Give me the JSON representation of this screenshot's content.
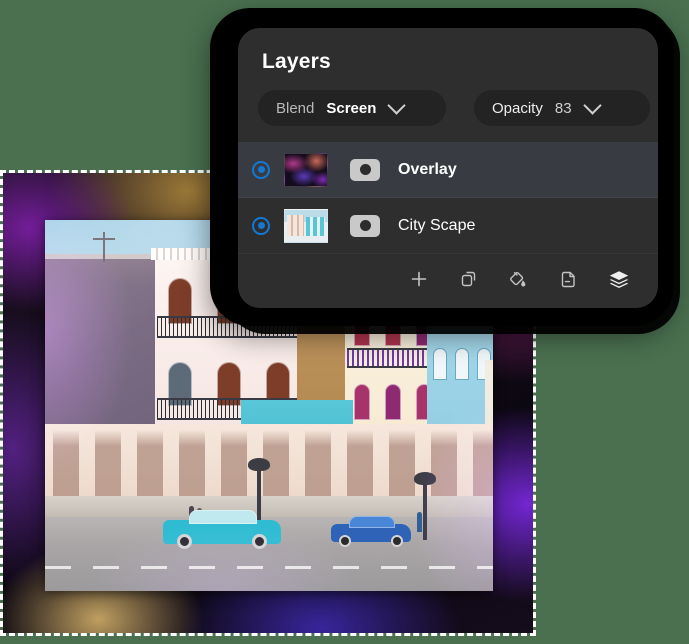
{
  "app": {
    "background_color": "#4a7050",
    "panel_bg": "#2e2e2e",
    "panel_frame_color": "#000000",
    "accent_color": "#1478d4",
    "selected_row_color": "#383c42"
  },
  "panel": {
    "title": "Layers",
    "controls": {
      "blend": {
        "label": "Blend",
        "value": "Screen",
        "chevron_icon": "chevron-down-icon"
      },
      "opacity": {
        "label": "Opacity",
        "value": "83",
        "chevron_icon": "chevron-down-icon"
      }
    },
    "layers": [
      {
        "name": "Overlay",
        "selected": true,
        "visible": true,
        "visibility_icon": "visibility-radio-icon",
        "thumbnail": "abstract-color-overlay-thumbnail",
        "mask_icon": "layer-mask-icon"
      },
      {
        "name": "City Scape",
        "selected": false,
        "visible": true,
        "visibility_icon": "visibility-radio-icon",
        "thumbnail": "city-scape-photo-thumbnail",
        "mask_icon": "layer-mask-icon"
      }
    ],
    "toolbar": [
      {
        "name": "add-layer-button",
        "icon": "plus-icon",
        "active": false
      },
      {
        "name": "duplicate-layer-button",
        "icon": "duplicate-icon",
        "active": false
      },
      {
        "name": "fill-button",
        "icon": "paint-bucket-icon",
        "active": false
      },
      {
        "name": "delete-layer-button",
        "icon": "page-minus-icon",
        "active": false
      },
      {
        "name": "layers-button",
        "icon": "layers-stack-icon",
        "active": true
      }
    ]
  },
  "canvas": {
    "selection_border": "dashed-marquee",
    "overlay_layer_name": "Overlay",
    "photo_layer_name": "City Scape",
    "photo_description": "Havana street scene with pastel colonial buildings, arcade colonnade and vintage cars"
  }
}
